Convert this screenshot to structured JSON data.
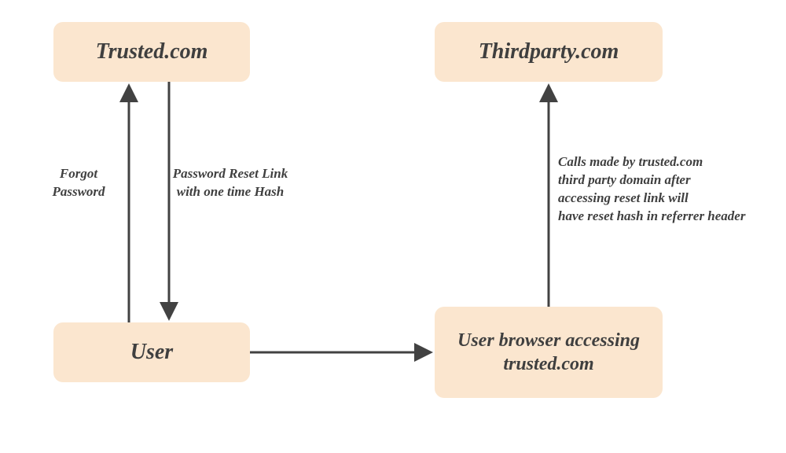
{
  "nodes": {
    "trusted": {
      "text": "Trusted.com"
    },
    "thirdparty": {
      "text": "Thirdparty.com"
    },
    "user": {
      "text": "User"
    },
    "browser": {
      "text": "User browser\naccessing\ntrusted.com"
    }
  },
  "labels": {
    "forgot": "Forgot\nPassword",
    "reset": "Password Reset Link\nwith one time Hash",
    "referrer": "Calls made by trusted.com\nthird party domain after\naccessing reset link will\nhave reset hash in referrer header"
  },
  "colors": {
    "box_fill": "#fbe6cf",
    "text": "#3f3f3f",
    "arrow": "#424242"
  }
}
